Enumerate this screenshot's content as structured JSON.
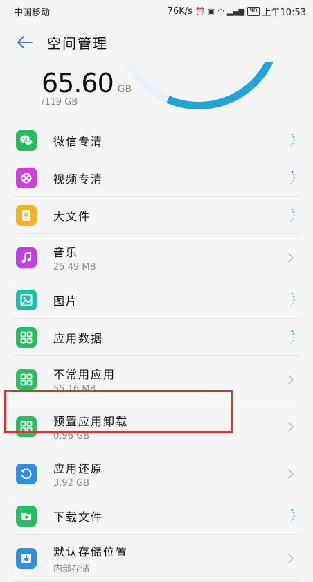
{
  "status": {
    "carrier": "中国移动",
    "net_speed": "76K/s",
    "battery": "90",
    "time": "上午10:53"
  },
  "header": {
    "title": "空间管理"
  },
  "storage": {
    "used_value": "65.60",
    "used_unit": "GB",
    "total": "/119 GB"
  },
  "items": [
    {
      "label": "微信专清",
      "sub": "",
      "color": "#1fbf5e",
      "icon": "wechat-icon",
      "right": "loading-icon"
    },
    {
      "label": "视频专清",
      "sub": "",
      "color": "#d43be0",
      "icon": "video-icon",
      "right": "loading-icon"
    },
    {
      "label": "大文件",
      "sub": "",
      "color": "#f5b321",
      "icon": "document-icon",
      "right": "loading-icon"
    },
    {
      "label": "音乐",
      "sub": "25.49 MB",
      "color": "#c53be6",
      "icon": "music-note-icon",
      "right": "chevron-right-icon"
    },
    {
      "label": "图片",
      "sub": "",
      "color": "#19c2a1",
      "icon": "image-icon",
      "right": "loading-icon"
    },
    {
      "label": "应用数据",
      "sub": "",
      "color": "#21c15d",
      "icon": "grid-icon",
      "right": "loading-icon"
    },
    {
      "label": "不常用应用",
      "sub": "55.16 MB",
      "color": "#21c15d",
      "icon": "grid-icon",
      "right": "chevron-right-icon"
    },
    {
      "label": "预置应用卸载",
      "sub": "0.96 GB",
      "color": "#21c15d",
      "icon": "grid-icon",
      "right": "chevron-right-icon"
    },
    {
      "label": "应用还原",
      "sub": "3.92 GB",
      "color": "#2b8ff0",
      "icon": "restore-icon",
      "right": "chevron-right-icon"
    },
    {
      "label": "下载文件",
      "sub": "",
      "color": "#21c15d",
      "icon": "download-folder-icon",
      "right": "loading-icon"
    },
    {
      "label": "默认存储位置",
      "sub": "内部存储",
      "color": "#2b8ff0",
      "icon": "download-icon",
      "right": "chevron-right-icon"
    }
  ],
  "highlight_color": "#e5302f"
}
